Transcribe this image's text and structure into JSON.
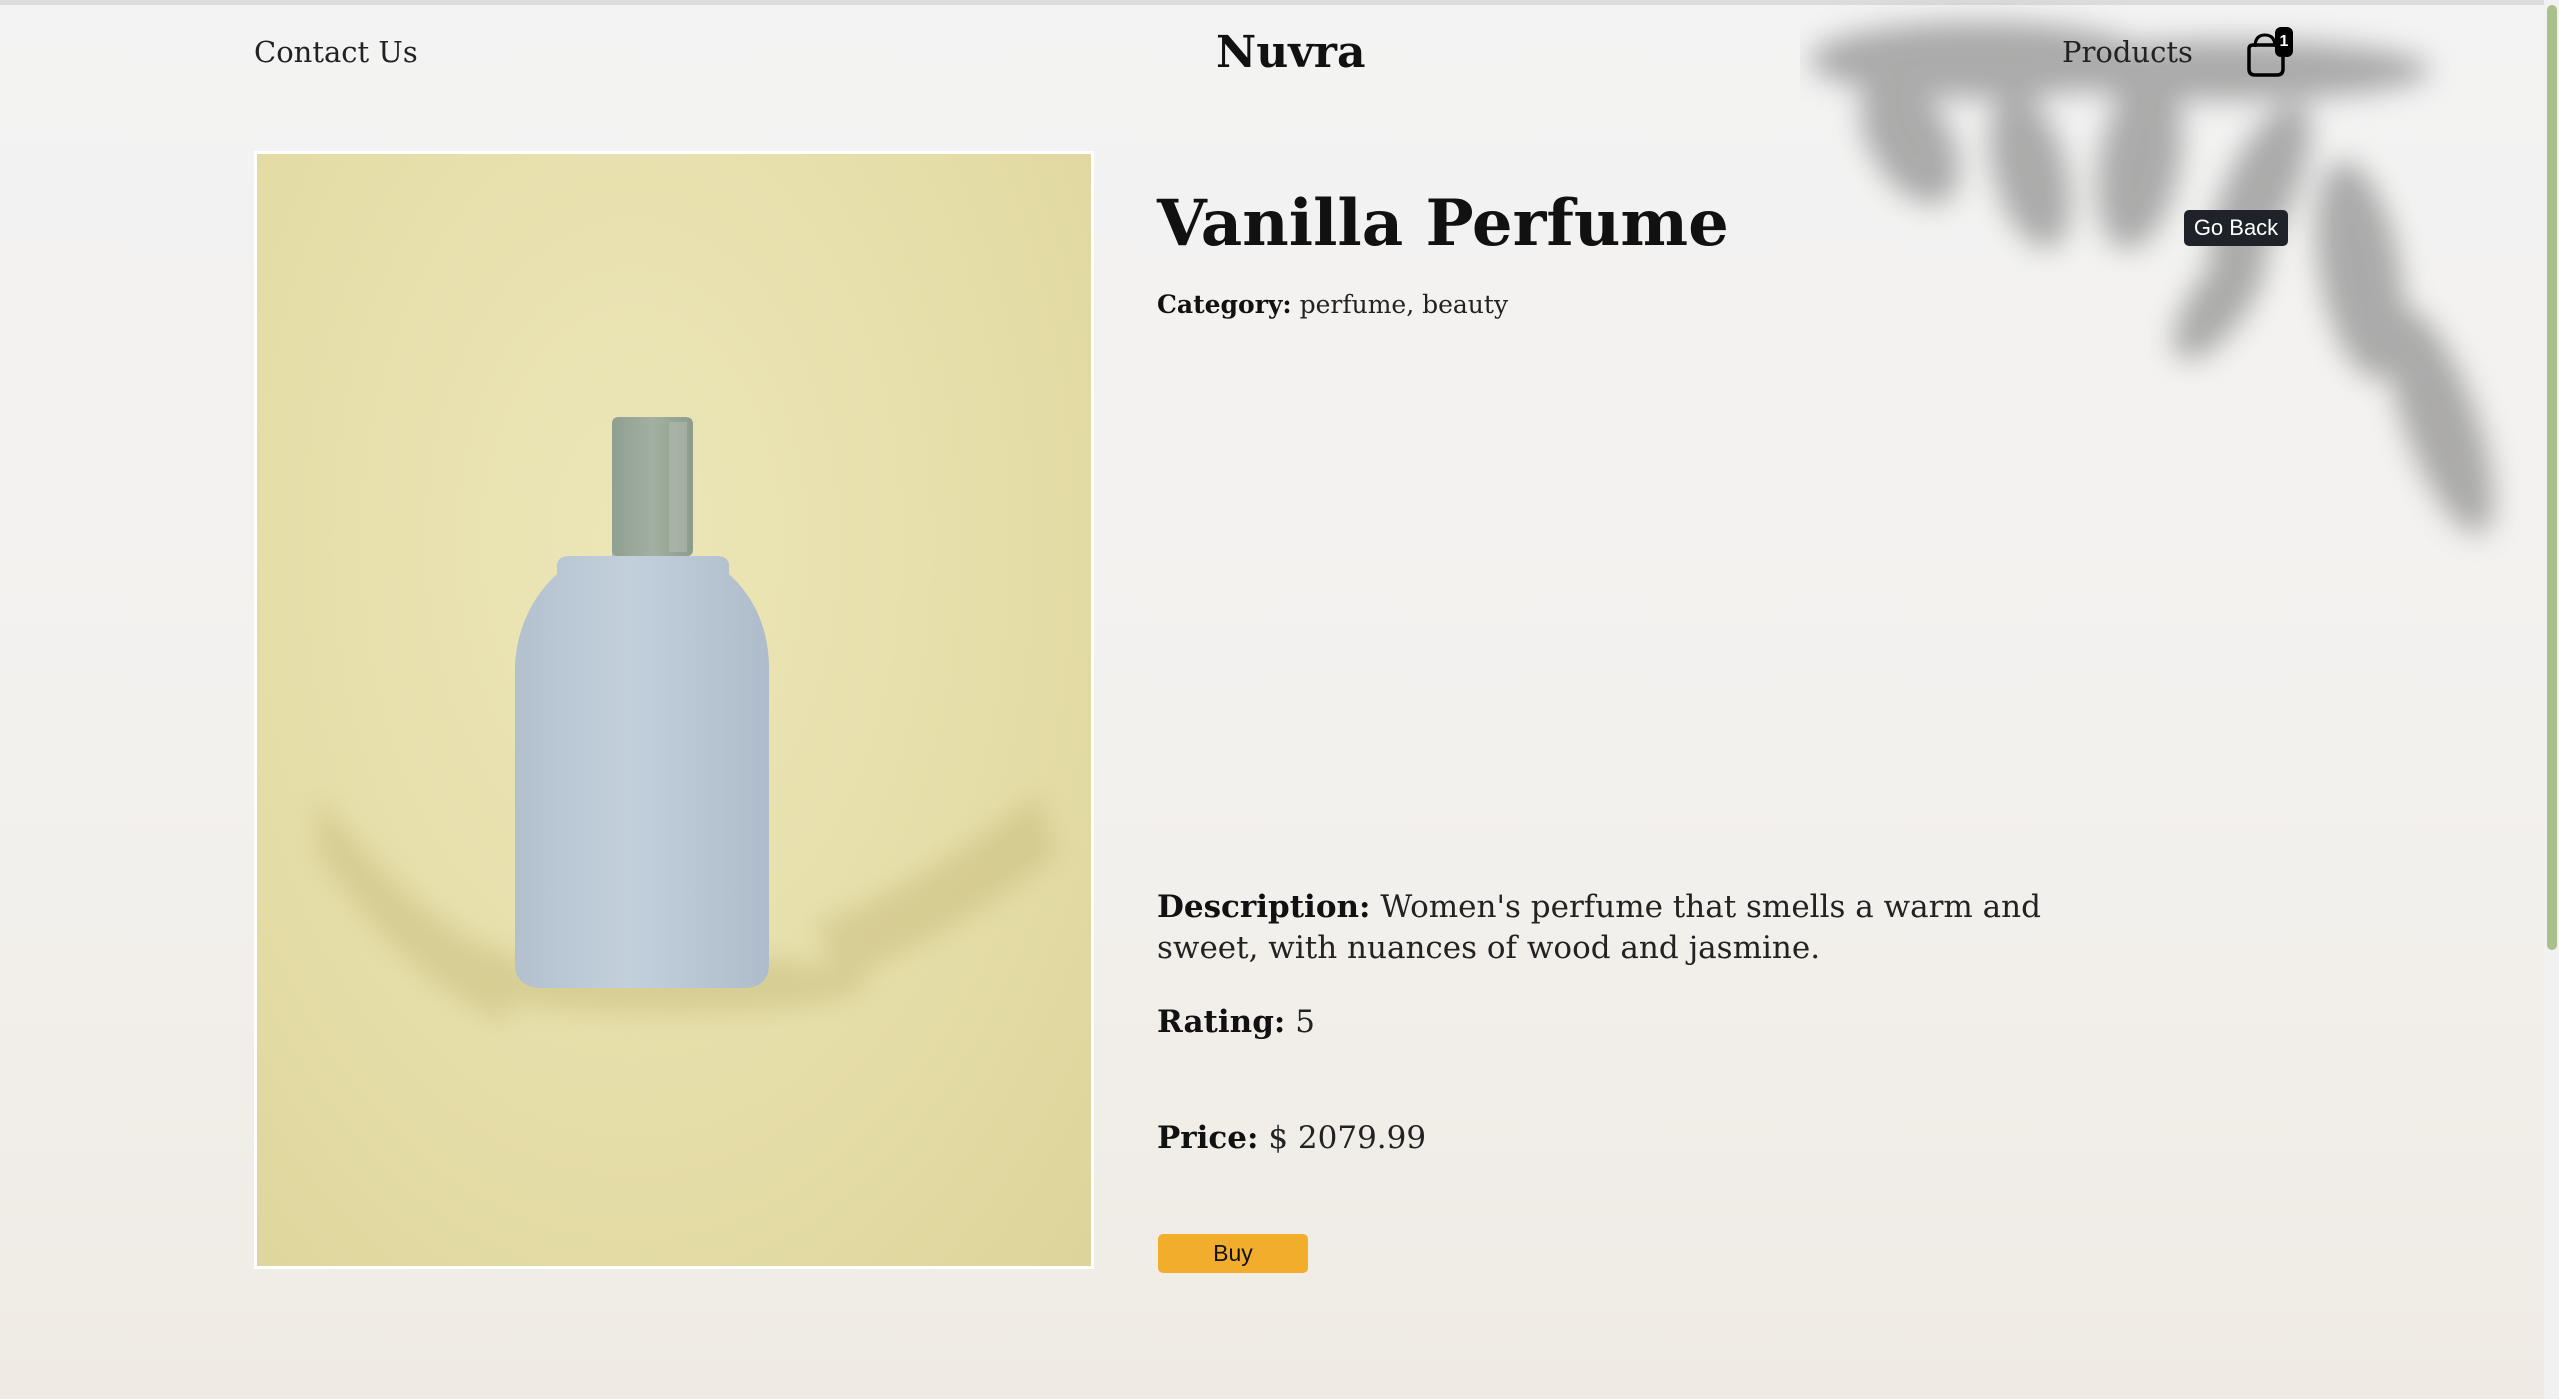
{
  "header": {
    "contact_label": "Contact Us",
    "brand": "Nuvra",
    "products_label": "Products",
    "cart_count": "1"
  },
  "product": {
    "title": "Vanilla Perfume",
    "go_back_label": "Go Back",
    "category_label": "Category:",
    "category_value": "perfume, beauty",
    "description_label": "Description:",
    "description_value": "Women's perfume that smells a warm and sweet, with nuances of wood and jasmine.",
    "rating_label": "Rating:",
    "rating_value": "5",
    "price_label": "Price:",
    "price_value": "$ 2079.99",
    "buy_label": "Buy"
  },
  "colors": {
    "accent_buy": "#f3ad2d",
    "go_back_bg": "#1f2329",
    "image_background": "#e6dea9",
    "bottle": "#bcc9d6",
    "bottle_cap": "#9aa99a"
  },
  "icons": {
    "cart": "shopping-bag-icon"
  }
}
